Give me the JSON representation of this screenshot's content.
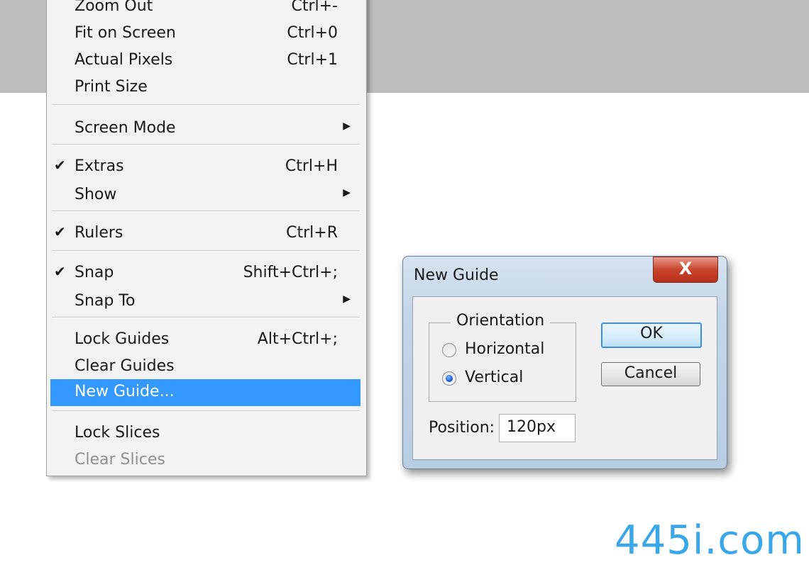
{
  "menu": {
    "items": [
      {
        "label": "Zoom Out",
        "shortcut": "Ctrl+-"
      },
      {
        "label": "Fit on Screen",
        "shortcut": "Ctrl+0"
      },
      {
        "label": "Actual Pixels",
        "shortcut": "Ctrl+1"
      },
      {
        "label": "Print Size",
        "shortcut": ""
      },
      {
        "label": "Screen Mode",
        "shortcut": ""
      },
      {
        "label": "Extras",
        "shortcut": "Ctrl+H"
      },
      {
        "label": "Show",
        "shortcut": ""
      },
      {
        "label": "Rulers",
        "shortcut": "Ctrl+R"
      },
      {
        "label": "Snap",
        "shortcut": "Shift+Ctrl+;"
      },
      {
        "label": "Snap To",
        "shortcut": ""
      },
      {
        "label": "Lock Guides",
        "shortcut": "Alt+Ctrl+;"
      },
      {
        "label": "Clear Guides",
        "shortcut": ""
      },
      {
        "label": "New Guide...",
        "shortcut": ""
      },
      {
        "label": "Lock Slices",
        "shortcut": ""
      },
      {
        "label": "Clear Slices",
        "shortcut": ""
      }
    ],
    "checkmark": "✔",
    "submenu_arrow": "▶"
  },
  "dialog": {
    "title": "New Guide",
    "close_glyph": "X",
    "orientation_label": "Orientation",
    "horizontal_label": "Horizontal",
    "vertical_label": "Vertical",
    "ok_label": "OK",
    "cancel_label": "Cancel",
    "position_label": "Position:",
    "position_value": "120px"
  },
  "watermark": "445i.com"
}
